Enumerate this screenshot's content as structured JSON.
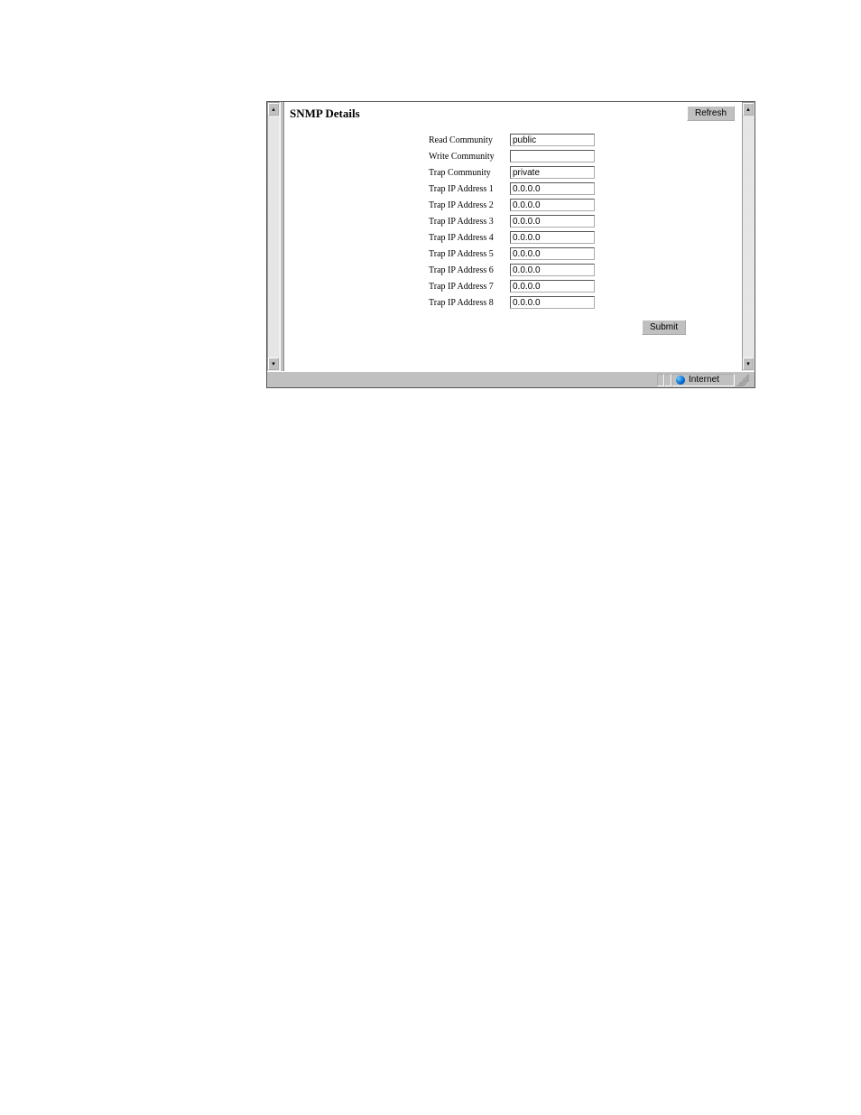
{
  "header": {
    "title": "SNMP Details",
    "refresh_label": "Refresh"
  },
  "form": {
    "rows": [
      {
        "label": "Read Community",
        "value": "public"
      },
      {
        "label": "Write Community",
        "value": ""
      },
      {
        "label": "Trap Community",
        "value": "private"
      },
      {
        "label": "Trap IP Address 1",
        "value": "0.0.0.0"
      },
      {
        "label": "Trap IP Address 2",
        "value": "0.0.0.0"
      },
      {
        "label": "Trap IP Address 3",
        "value": "0.0.0.0"
      },
      {
        "label": "Trap IP Address 4",
        "value": "0.0.0.0"
      },
      {
        "label": "Trap IP Address 5",
        "value": "0.0.0.0"
      },
      {
        "label": "Trap IP Address 6",
        "value": "0.0.0.0"
      },
      {
        "label": "Trap IP Address 7",
        "value": "0.0.0.0"
      },
      {
        "label": "Trap IP Address 8",
        "value": "0.0.0.0"
      }
    ],
    "submit_label": "Submit"
  },
  "statusbar": {
    "zone": "Internet"
  }
}
